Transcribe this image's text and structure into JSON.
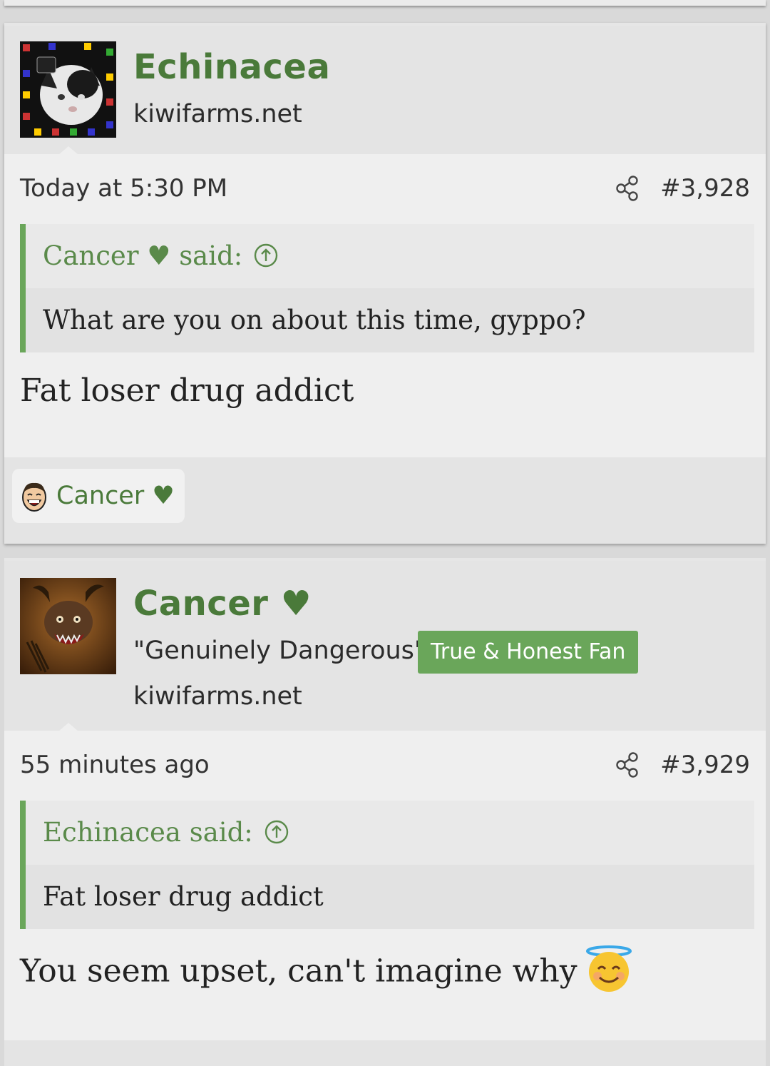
{
  "posts": [
    {
      "username": "Echinacea",
      "site": "kiwifarms.net",
      "time": "Today at 5:30 PM",
      "number": "#3,928",
      "quote_author": "Cancer ♥ said:",
      "quote_text": "What are you on about this time, gyppo?",
      "message": "Fat loser drug addict",
      "reactions": [
        {
          "name": "Cancer ♥",
          "icon": "laughing-face-icon"
        }
      ]
    },
    {
      "username": "Cancer ♥",
      "user_title": "\"Genuinely Dangerous\"",
      "banner": "True & Honest Fan",
      "site": "kiwifarms.net",
      "time": "55 minutes ago",
      "number": "#3,929",
      "quote_author": "Echinacea said:",
      "quote_text": "Fat loser drug addict",
      "message": "You seem upset, can't imagine why",
      "message_emoji": "smiling-face-with-halo-icon"
    }
  ],
  "colors": {
    "accent": "#4a7a3a",
    "banner": "#6aa65a",
    "quote_bar": "#6aa65a"
  }
}
